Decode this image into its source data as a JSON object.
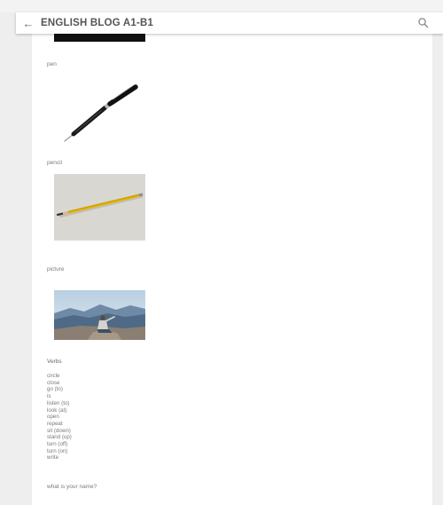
{
  "header": {
    "back_icon": "arrow-left-icon",
    "title": "ENGLISH BLOG A1-B1",
    "search_icon": "search-icon"
  },
  "post": {
    "items": [
      {
        "label": "pen"
      },
      {
        "label": "pencil"
      },
      {
        "label": "picture"
      }
    ],
    "verbs_heading": "Verbs",
    "verbs": [
      "circle",
      "close",
      "go (to)",
      "is",
      "listen (to)",
      "look (at)",
      "open",
      "repeat",
      "sit (down)",
      "stand (up)",
      "turn (off)",
      "turn (on)",
      "write"
    ],
    "question": "what is your name?"
  }
}
